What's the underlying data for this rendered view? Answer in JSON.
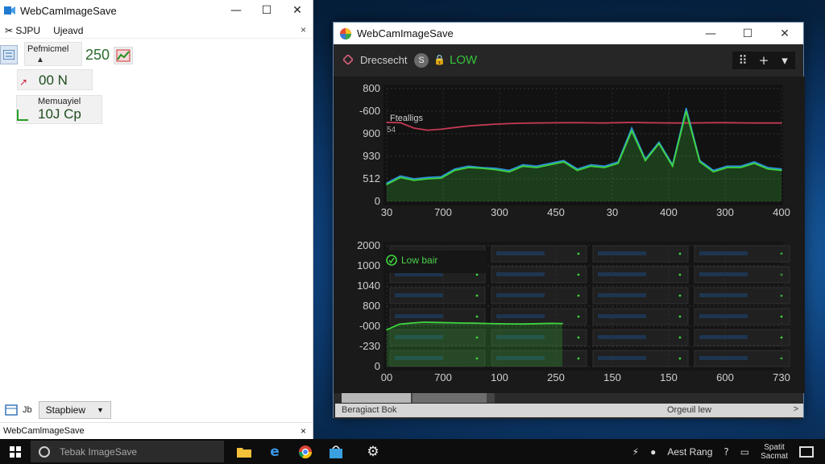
{
  "left_window": {
    "title": "WebCamImageSave",
    "window_controls": {
      "minimize": "—",
      "maximize": "☐",
      "close": "✕"
    },
    "menu": [
      {
        "label": "SJPU",
        "icon": "tools-icon"
      },
      {
        "label": "Ujeavd"
      }
    ],
    "menu_close": "×",
    "perf_card": {
      "label": "Pefmicmel",
      "arrow": "▲"
    },
    "perf_value": "250",
    "n_card": {
      "mark": "↗",
      "value": "00  N"
    },
    "mem_card": {
      "label": "Memuayiel",
      "value": "10J  Cp"
    },
    "bottom": {
      "count": "Jb",
      "dropdown_label": "Stapbiew",
      "dropdown_caret": "▼"
    },
    "status_title": "WebCamlmageSave",
    "status_close": "×"
  },
  "right_window": {
    "title": "WebCamImageSave",
    "window_controls": {
      "minimize": "—",
      "maximize": "☐",
      "close": "✕"
    },
    "toolbar": {
      "label": "Drecsecht",
      "badge": "S",
      "lock": "🔒",
      "status": "LOW",
      "buttons": [
        "⠿",
        "+",
        "▾"
      ]
    },
    "statusbar": {
      "left": "Beragiact Bok",
      "right": "Orgeuil lew",
      "arrow": ">"
    }
  },
  "chart_data": [
    {
      "type": "line",
      "title": "Ftealligs",
      "subtitle": "54",
      "y_ticks": [
        "800",
        "-600",
        "900",
        "930",
        "512",
        "0"
      ],
      "x_ticks": [
        "30",
        "700",
        "300",
        "450",
        "30",
        "400",
        "300",
        "400"
      ],
      "ylim": [
        0,
        800
      ],
      "series": [
        {
          "color": "#c43a55",
          "values": [
            560,
            558,
            520,
            505,
            512,
            524,
            535,
            542,
            548,
            552,
            555,
            556,
            557,
            558,
            558,
            557,
            556,
            558,
            560,
            558,
            557,
            556,
            556,
            557,
            558,
            558,
            557,
            556,
            556,
            556
          ]
        },
        {
          "color": "#2b8fd6",
          "values": [
            130,
            180,
            160,
            170,
            175,
            230,
            250,
            240,
            235,
            220,
            260,
            250,
            270,
            290,
            230,
            260,
            250,
            280,
            520,
            300,
            420,
            260,
            660,
            290,
            220,
            250,
            250,
            280,
            240,
            230
          ]
        },
        {
          "color": "#3ed43e",
          "values": [
            120,
            170,
            150,
            160,
            165,
            220,
            240,
            235,
            225,
            210,
            250,
            240,
            260,
            280,
            220,
            250,
            240,
            270,
            500,
            290,
            410,
            250,
            640,
            280,
            210,
            240,
            240,
            270,
            230,
            220
          ]
        }
      ]
    },
    {
      "type": "area",
      "title": "",
      "annotation": "Low bair",
      "y_ticks": [
        "2000",
        "1000",
        "1040",
        "800",
        "-000",
        "-230",
        "0"
      ],
      "x_ticks": [
        "00",
        "700",
        "100",
        "250",
        "150",
        "150",
        "600",
        "730"
      ],
      "ylim": [
        0,
        2000
      ],
      "series": [
        {
          "color": "#3ed43e",
          "values": [
            610,
            700,
            720,
            735,
            730,
            725,
            720,
            718,
            712,
            708,
            705,
            704,
            710,
            715,
            712
          ]
        }
      ]
    }
  ],
  "taskbar": {
    "search_placeholder": "Tebak ImageSave",
    "apps": [
      "file-explorer-icon",
      "edge-icon",
      "chrome-icon",
      "store-icon",
      "settings-icon"
    ],
    "tray_text": "Aest Rang",
    "clock_line1": "Spatit",
    "clock_line2": "Sacmat"
  }
}
